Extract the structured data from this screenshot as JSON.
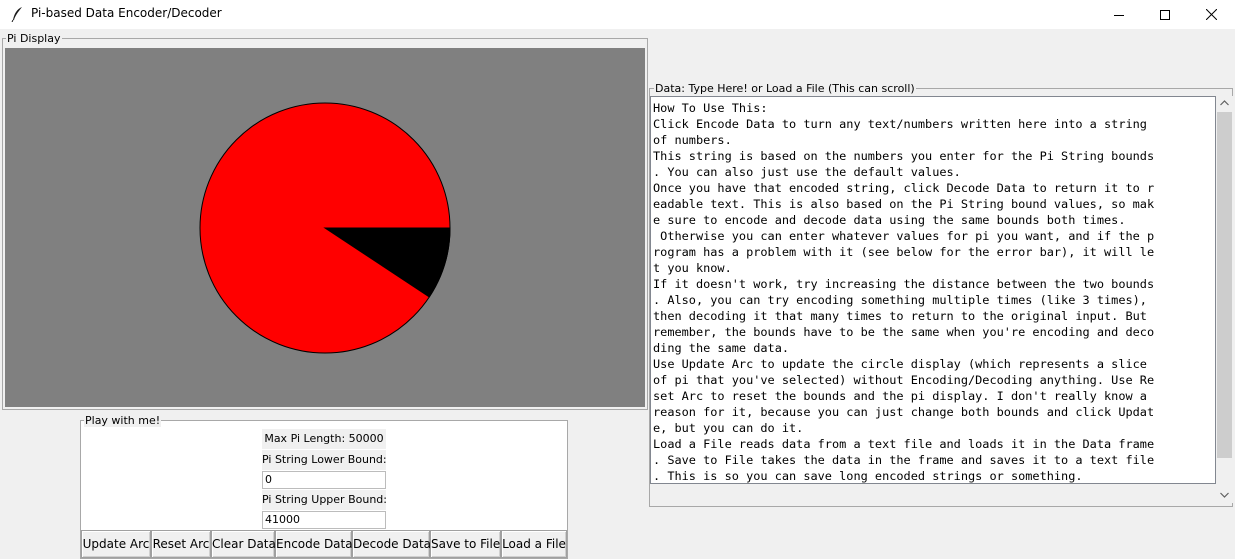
{
  "window": {
    "title": "Pi-based Data Encoder/Decoder",
    "icon": "feather-icon"
  },
  "pi_display": {
    "label": "Pi Display",
    "background_color": "#808080",
    "circle_color": "#ff0000",
    "arc_color": "#000000",
    "arc_extent_fraction": 0.093
  },
  "play": {
    "label": "Play with me!",
    "max_pi_length_label": "Max Pi Length: 50000",
    "lower_bound_label": "Pi String Lower Bound:",
    "lower_bound_value": "0",
    "upper_bound_label": "Pi String Upper Bound:",
    "upper_bound_value": "41000",
    "buttons": {
      "update_arc": "Update Arc",
      "reset_arc": "Reset Arc",
      "clear_data": "Clear Data",
      "encode_data": "Encode Data",
      "decode_data": "Decode Data",
      "save_to_file": "Save to File",
      "load_a_file": "Load a File"
    }
  },
  "data": {
    "label": "Data: Type Here! or Load a File (This can scroll)",
    "lines": [
      "How To Use This:",
      "Click Encode Data to turn any text/numbers written here into a string",
      "of numbers.",
      "This string is based on the numbers you enter for the Pi String bounds",
      ". You can also just use the default values.",
      "Once you have that encoded string, click Decode Data to return it to r",
      "eadable text. This is also based on the Pi String bound values, so mak",
      "e sure to encode and decode data using the same bounds both times.",
      " Otherwise you can enter whatever values for pi you want, and if the p",
      "rogram has a problem with it (see below for the error bar), it will le",
      "t you know.",
      "If it doesn't work, try increasing the distance between the two bounds",
      ". Also, you can try encoding something multiple times (like 3 times),",
      "then decoding it that many times to return to the original input. But",
      "remember, the bounds have to be the same when you're encoding and deco",
      "ding the same data.",
      "Use Update Arc to update the circle display (which represents a slice",
      "of pi that you've selected) without Encoding/Decoding anything. Use Re",
      "set Arc to reset the bounds and the pi display. I don't really know a",
      "reason for it, because you can just change both bounds and click Updat",
      "e, but you can do it.",
      "Load a File reads data from a text file and loads it in the Data frame",
      ". Save to File takes the data in the frame and saves it to a text file",
      ". This is so you can save long encoded strings or something."
    ]
  }
}
